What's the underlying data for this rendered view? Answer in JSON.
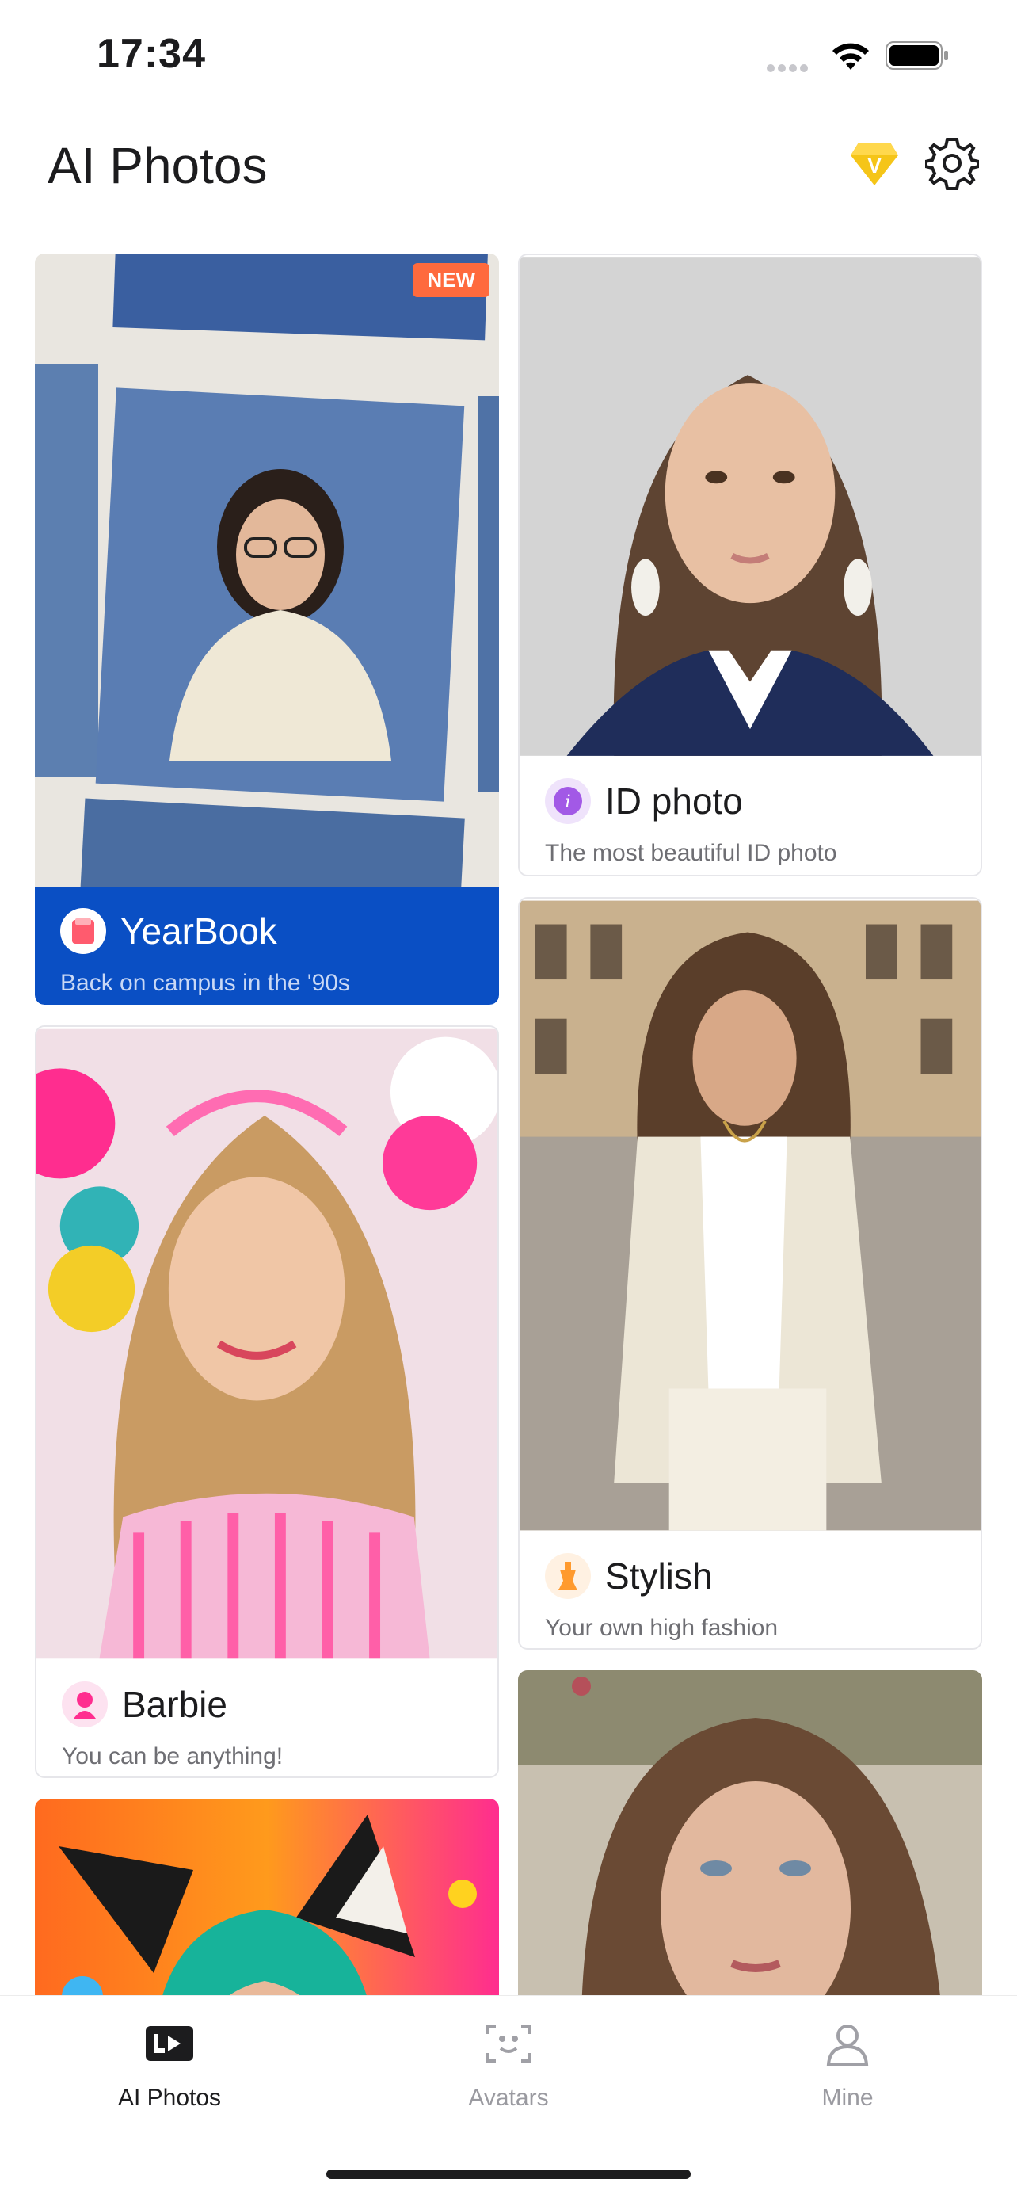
{
  "status_bar": {
    "time": "17:34"
  },
  "header": {
    "title": "AI Photos"
  },
  "cards": {
    "yearbook": {
      "title": "YearBook",
      "subtitle": "Back on campus in the '90s",
      "badge": "NEW"
    },
    "id_photo": {
      "title": "ID photo",
      "subtitle": "The most beautiful ID photo"
    },
    "stylish": {
      "title": "Stylish",
      "subtitle": "Your own high fashion"
    },
    "barbie": {
      "title": "Barbie",
      "subtitle": "You can be anything!"
    }
  },
  "tabs": {
    "ai_photos": "AI Photos",
    "avatars": "Avatars",
    "mine": "Mine"
  },
  "colors": {
    "yearbook_panel": "#0a4fc4",
    "badge": "#ff6a3d",
    "vip_gold": "#f5c518"
  }
}
